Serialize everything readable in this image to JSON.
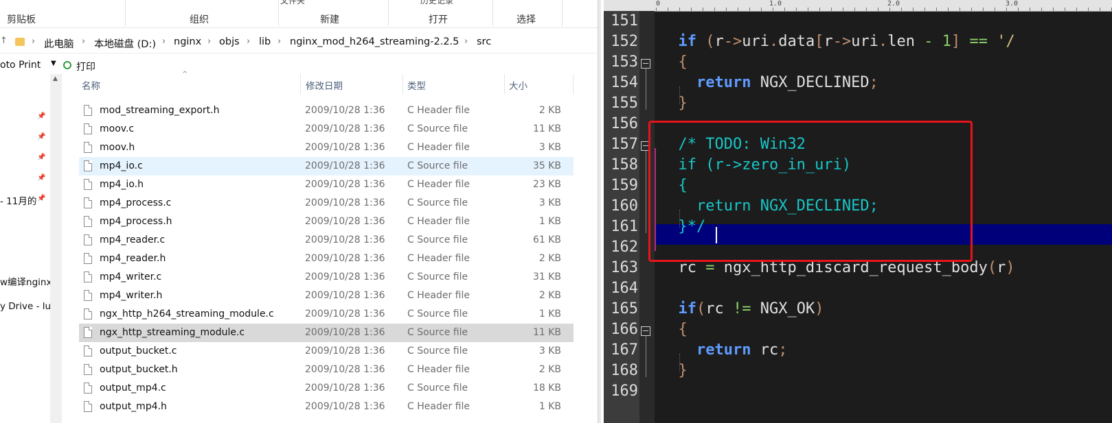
{
  "ribbon": {
    "groups": [
      "剪贴板",
      "组织",
      "新建",
      "打开",
      "选择"
    ],
    "top_fragments": [
      "文件夹",
      "历史记录"
    ]
  },
  "breadcrumb": [
    "此电脑",
    "本地磁盘 (D:)",
    "nginx",
    "objs",
    "lib",
    "nginx_mod_h264_streaming-2.2.5",
    "src"
  ],
  "command_bar": {
    "photo_print": "oto Print",
    "print": "打印"
  },
  "nav_pane": [
    "- 11月的",
    "w编译nginx",
    "y Drive - lu"
  ],
  "columns": {
    "name": "名称",
    "date": "修改日期",
    "type": "类型",
    "size": "大小"
  },
  "files": [
    {
      "name": "mod_streaming_export.h",
      "date": "2009/10/28 1:36",
      "type": "C Header file",
      "size": "2 KB"
    },
    {
      "name": "moov.c",
      "date": "2009/10/28 1:36",
      "type": "C Source file",
      "size": "11 KB"
    },
    {
      "name": "moov.h",
      "date": "2009/10/28 1:36",
      "type": "C Header file",
      "size": "3 KB"
    },
    {
      "name": "mp4_io.c",
      "date": "2009/10/28 1:36",
      "type": "C Source file",
      "size": "35 KB"
    },
    {
      "name": "mp4_io.h",
      "date": "2009/10/28 1:36",
      "type": "C Header file",
      "size": "23 KB"
    },
    {
      "name": "mp4_process.c",
      "date": "2009/10/28 1:36",
      "type": "C Source file",
      "size": "3 KB"
    },
    {
      "name": "mp4_process.h",
      "date": "2009/10/28 1:36",
      "type": "C Header file",
      "size": "1 KB"
    },
    {
      "name": "mp4_reader.c",
      "date": "2009/10/28 1:36",
      "type": "C Source file",
      "size": "61 KB"
    },
    {
      "name": "mp4_reader.h",
      "date": "2009/10/28 1:36",
      "type": "C Header file",
      "size": "2 KB"
    },
    {
      "name": "mp4_writer.c",
      "date": "2009/10/28 1:36",
      "type": "C Source file",
      "size": "31 KB"
    },
    {
      "name": "mp4_writer.h",
      "date": "2009/10/28 1:36",
      "type": "C Header file",
      "size": "2 KB"
    },
    {
      "name": "ngx_http_h264_streaming_module.c",
      "date": "2009/10/28 1:36",
      "type": "C Source file",
      "size": "1 KB"
    },
    {
      "name": "ngx_http_streaming_module.c",
      "date": "2009/10/28 1:36",
      "type": "C Source file",
      "size": "11 KB"
    },
    {
      "name": "output_bucket.c",
      "date": "2009/10/28 1:36",
      "type": "C Source file",
      "size": "3 KB"
    },
    {
      "name": "output_bucket.h",
      "date": "2009/10/28 1:36",
      "type": "C Header file",
      "size": "2 KB"
    },
    {
      "name": "output_mp4.c",
      "date": "2009/10/28 1:36",
      "type": "C Source file",
      "size": "18 KB"
    },
    {
      "name": "output_mp4.h",
      "date": "2009/10/28 1:36",
      "type": "C Header file",
      "size": "1 KB"
    }
  ],
  "ruler": [
    "0",
    "1.0",
    "2.0",
    "3.0"
  ],
  "editor": {
    "line_numbers": [
      "151",
      "152",
      "153",
      "154",
      "155",
      "156",
      "157",
      "158",
      "159",
      "160",
      "161",
      "162",
      "163",
      "164",
      "165",
      "166",
      "167",
      "168",
      "169"
    ],
    "lines": [
      [],
      [
        {
          "t": "  "
        },
        {
          "t": "if",
          "c": "kw"
        },
        {
          "t": " "
        },
        {
          "t": "(",
          "c": "op"
        },
        {
          "t": "r"
        },
        {
          "t": "->",
          "c": "op"
        },
        {
          "t": "uri"
        },
        {
          "t": ".",
          "c": "op"
        },
        {
          "t": "data"
        },
        {
          "t": "[",
          "c": "op"
        },
        {
          "t": "r"
        },
        {
          "t": "->",
          "c": "op"
        },
        {
          "t": "uri"
        },
        {
          "t": ".",
          "c": "op"
        },
        {
          "t": "len "
        },
        {
          "t": "- 1",
          "c": "num"
        },
        {
          "t": "] ",
          "c": "op"
        },
        {
          "t": "==",
          "c": "eq"
        },
        {
          "t": " '/",
          "c": "str"
        }
      ],
      [
        {
          "t": "  "
        },
        {
          "t": "{",
          "c": "op"
        }
      ],
      [
        {
          "t": "    "
        },
        {
          "t": "return",
          "c": "kw"
        },
        {
          "t": " NGX_DECLINED"
        },
        {
          "t": ";",
          "c": "op"
        }
      ],
      [
        {
          "t": "  "
        },
        {
          "t": "}",
          "c": "op"
        }
      ],
      [],
      [
        {
          "t": "  "
        },
        {
          "t": "/* TODO: Win32",
          "c": "cm"
        }
      ],
      [
        {
          "t": "  "
        },
        {
          "t": "if (r->zero_in_uri)",
          "c": "cm"
        }
      ],
      [
        {
          "t": "  "
        },
        {
          "t": "{",
          "c": "cm"
        }
      ],
      [
        {
          "t": "    "
        },
        {
          "t": "return NGX_DECLINED;",
          "c": "cm"
        }
      ],
      [
        {
          "t": "  "
        },
        {
          "t": "}*/",
          "c": "cm"
        }
      ],
      [],
      [
        {
          "t": "  rc "
        },
        {
          "t": "=",
          "c": "eq"
        },
        {
          "t": " ngx_http_discard_request_body"
        },
        {
          "t": "(",
          "c": "op"
        },
        {
          "t": "r"
        },
        {
          "t": ")",
          "c": "op"
        }
      ],
      [],
      [
        {
          "t": "  "
        },
        {
          "t": "if",
          "c": "kw"
        },
        {
          "t": "(",
          "c": "op"
        },
        {
          "t": "rc "
        },
        {
          "t": "!=",
          "c": "eq"
        },
        {
          "t": " NGX_OK"
        },
        {
          "t": ")",
          "c": "op"
        }
      ],
      [
        {
          "t": "  "
        },
        {
          "t": "{",
          "c": "op"
        }
      ],
      [
        {
          "t": "    "
        },
        {
          "t": "return",
          "c": "kw"
        },
        {
          "t": " rc"
        },
        {
          "t": ";",
          "c": "op"
        }
      ],
      [
        {
          "t": "  "
        },
        {
          "t": "}",
          "c": "op"
        }
      ],
      []
    ]
  },
  "colors": {
    "keyword": "#5f9cff",
    "operator": "#c09070",
    "number": "#8fd16a",
    "comment": "#19c6c8",
    "string": "#d7c07a",
    "text": "#e0e0e0",
    "current_line": "#00007a",
    "highlight_box": "#e8141b"
  }
}
